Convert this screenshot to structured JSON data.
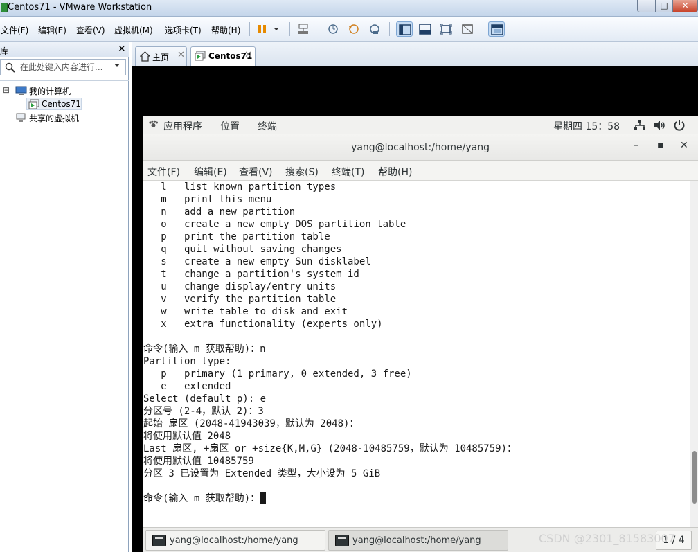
{
  "window": {
    "title": "Centos71 - VMware Workstation",
    "min": "–",
    "max": "□",
    "close": "✕"
  },
  "menubar": {
    "items": [
      "文件(F)",
      "编辑(E)",
      "查看(V)",
      "虚拟机(M)",
      "选项卡(T)",
      "帮助(H)"
    ]
  },
  "library": {
    "title": "库",
    "close": "✕",
    "search_placeholder": "在此处键入内容进行...",
    "tree": {
      "expander": "⊟",
      "my_computer": "我的计算机",
      "vm": "Centos71",
      "shared": "共享的虚拟机"
    }
  },
  "tabs": [
    {
      "label": "主页",
      "close": "✕"
    },
    {
      "label": "Centos71",
      "close": "✕"
    }
  ],
  "gnome_bar": {
    "applications": "应用程序",
    "places": "位置",
    "terminal": "终端",
    "clock": "星期四 15：58"
  },
  "terminal": {
    "title": "yang@localhost:/home/yang",
    "minimize": "–",
    "maximize": "▪",
    "close": "✕",
    "menu": [
      "文件(F)",
      "编辑(E)",
      "查看(V)",
      "搜索(S)",
      "终端(T)",
      "帮助(H)"
    ],
    "lines": [
      "   l   list known partition types",
      "   m   print this menu",
      "   n   add a new partition",
      "   o   create a new empty DOS partition table",
      "   p   print the partition table",
      "   q   quit without saving changes",
      "   s   create a new empty Sun disklabel",
      "   t   change a partition's system id",
      "   u   change display/entry units",
      "   v   verify the partition table",
      "   w   write table to disk and exit",
      "   x   extra functionality (experts only)",
      "",
      "命令(输入 m 获取帮助)：n",
      "Partition type:",
      "   p   primary (1 primary, 0 extended, 3 free)",
      "   e   extended",
      "Select (default p): e",
      "分区号 (2-4，默认 2)：3",
      "起始 扇区 (2048-41943039，默认为 2048)：",
      "将使用默认值 2048",
      "Last 扇区, +扇区 or +size{K,M,G} (2048-10485759，默认为 10485759)：",
      "将使用默认值 10485759",
      "分区 3 已设置为 Extended 类型，大小设为 5 GiB",
      "",
      "命令(输入 m 获取帮助)："
    ]
  },
  "taskbar": {
    "tasks": [
      "yang@localhost:/home/yang",
      "yang@localhost:/home/yang"
    ],
    "pager": "1 / 4"
  },
  "watermark": "CSDN @2301_81583007"
}
